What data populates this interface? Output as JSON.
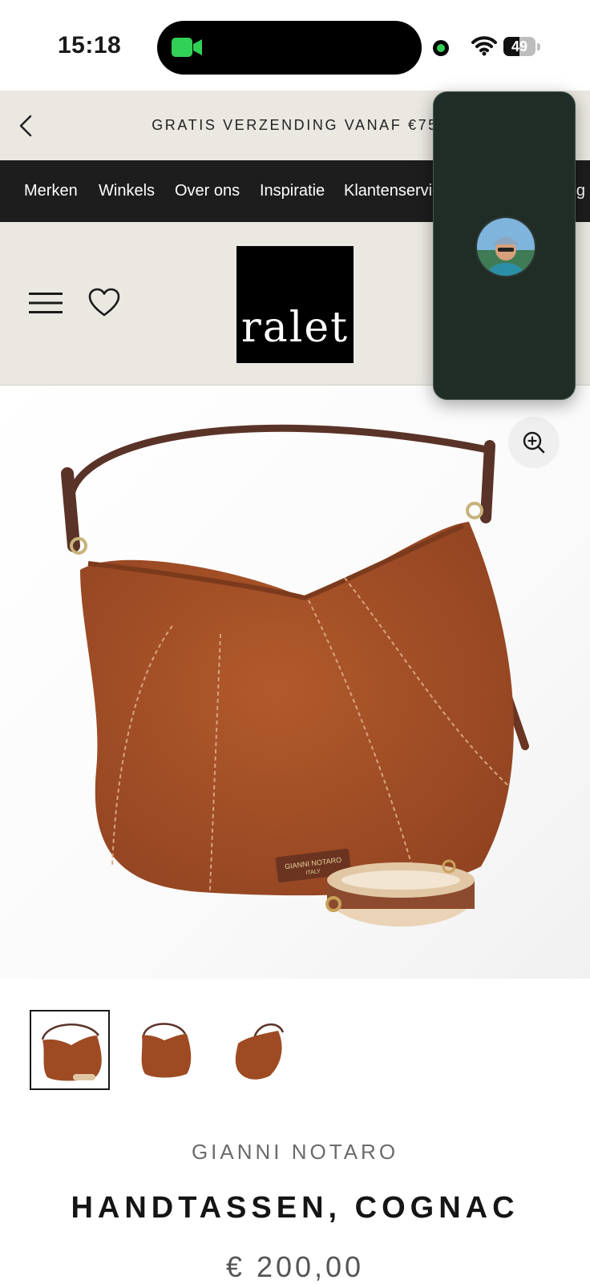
{
  "status_bar": {
    "time": "15:18",
    "battery_text": "49",
    "battery_level": 0.49
  },
  "promo_banner": {
    "text": "GRATIS VERZENDING VANAF €75"
  },
  "nav": {
    "items": [
      "Merken",
      "Winkels",
      "Over ons",
      "Inspiratie",
      "Klantenservice",
      "Blog"
    ]
  },
  "header": {
    "logo_text": "ralet"
  },
  "product": {
    "brand": "GIANNI NOTARO",
    "title": "HANDTASSEN, COGNAC",
    "price": "€ 200,00",
    "bag_label_line1": "GIANNI NOTARO",
    "bag_label_line2": "ITALY",
    "thumbnails_count": 3,
    "selected_thumbnail": 1
  },
  "colors": {
    "nav_bg": "#1d1d1d",
    "banner_bg": "#ebe8e2",
    "bag": "#a04e24",
    "pip_bg": "#1f2d26",
    "facetime_green": "#31d158"
  }
}
